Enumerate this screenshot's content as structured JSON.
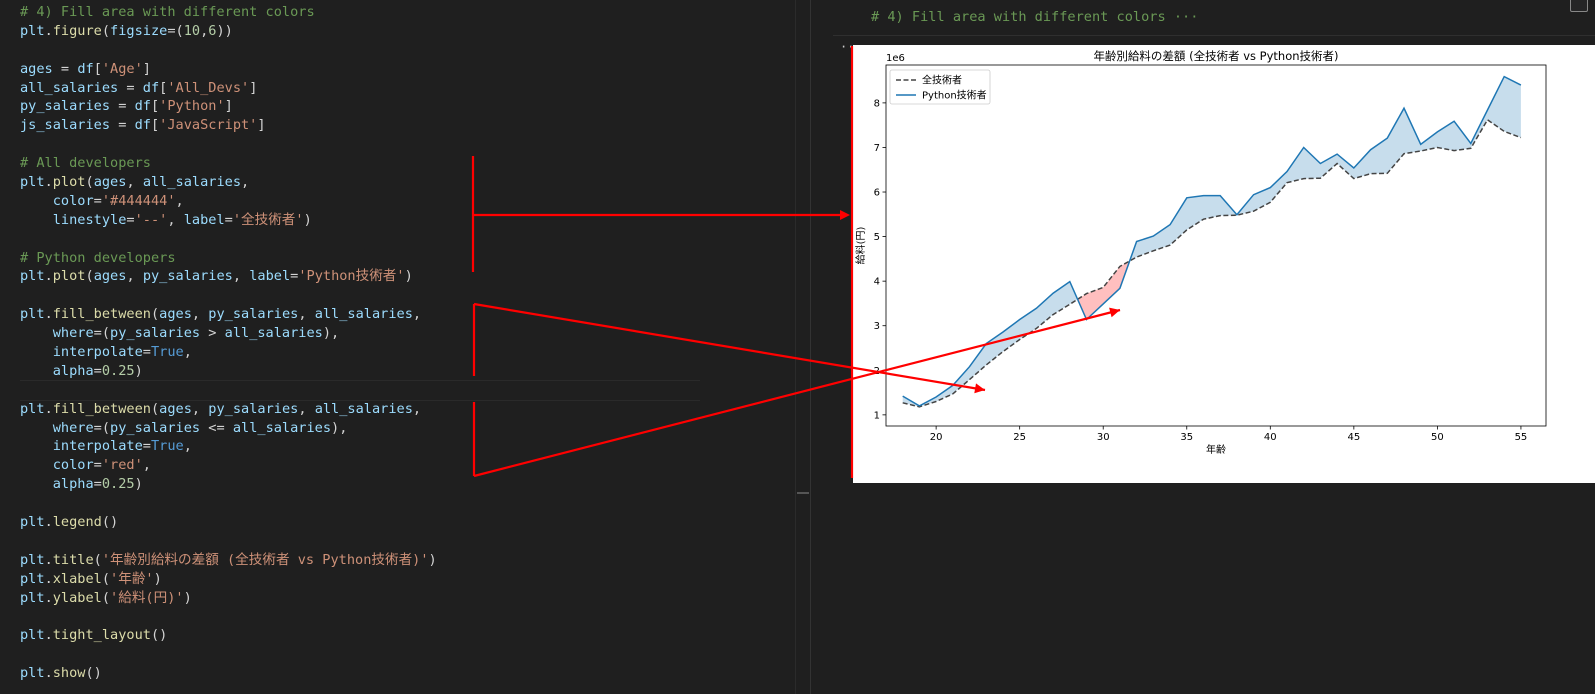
{
  "code": {
    "lines": [
      [
        [
          "t-com",
          "# 4) Fill area with different colors"
        ]
      ],
      [
        [
          "t-var",
          "plt"
        ],
        [
          "t-op",
          "."
        ],
        [
          "t-fn",
          "figure"
        ],
        [
          "t-op",
          "("
        ],
        [
          "t-var",
          "figsize"
        ],
        [
          "t-op",
          "=("
        ],
        [
          "t-num",
          "10"
        ],
        [
          "t-op",
          ","
        ],
        [
          "t-num",
          "6"
        ],
        [
          "t-op",
          "))"
        ]
      ],
      [],
      [
        [
          "t-var",
          "ages"
        ],
        [
          "t-op",
          " = "
        ],
        [
          "t-var",
          "df"
        ],
        [
          "t-op",
          "["
        ],
        [
          "t-str",
          "'Age'"
        ],
        [
          "t-op",
          "]"
        ]
      ],
      [
        [
          "t-var",
          "all_salaries"
        ],
        [
          "t-op",
          " = "
        ],
        [
          "t-var",
          "df"
        ],
        [
          "t-op",
          "["
        ],
        [
          "t-str",
          "'All_Devs'"
        ],
        [
          "t-op",
          "]"
        ]
      ],
      [
        [
          "t-var",
          "py_salaries"
        ],
        [
          "t-op",
          " = "
        ],
        [
          "t-var",
          "df"
        ],
        [
          "t-op",
          "["
        ],
        [
          "t-str",
          "'Python'"
        ],
        [
          "t-op",
          "]"
        ]
      ],
      [
        [
          "t-var",
          "js_salaries"
        ],
        [
          "t-op",
          " = "
        ],
        [
          "t-var",
          "df"
        ],
        [
          "t-op",
          "["
        ],
        [
          "t-str",
          "'JavaScript'"
        ],
        [
          "t-op",
          "]"
        ]
      ],
      [],
      [
        [
          "t-com",
          "# All developers"
        ]
      ],
      [
        [
          "t-var",
          "plt"
        ],
        [
          "t-op",
          "."
        ],
        [
          "t-fn",
          "plot"
        ],
        [
          "t-op",
          "("
        ],
        [
          "t-var",
          "ages"
        ],
        [
          "t-op",
          ", "
        ],
        [
          "t-var",
          "all_salaries"
        ],
        [
          "t-op",
          ","
        ]
      ],
      [
        [
          "t-op",
          "    "
        ],
        [
          "t-var",
          "color"
        ],
        [
          "t-op",
          "="
        ],
        [
          "t-str",
          "'#444444'"
        ],
        [
          "t-op",
          ","
        ]
      ],
      [
        [
          "t-op",
          "    "
        ],
        [
          "t-var",
          "linestyle"
        ],
        [
          "t-op",
          "="
        ],
        [
          "t-str",
          "'--'"
        ],
        [
          "t-op",
          ", "
        ],
        [
          "t-var",
          "label"
        ],
        [
          "t-op",
          "="
        ],
        [
          "t-str",
          "'全技術者'"
        ],
        [
          "t-op",
          ")"
        ]
      ],
      [],
      [
        [
          "t-com",
          "# Python developers"
        ]
      ],
      [
        [
          "t-var",
          "plt"
        ],
        [
          "t-op",
          "."
        ],
        [
          "t-fn",
          "plot"
        ],
        [
          "t-op",
          "("
        ],
        [
          "t-var",
          "ages"
        ],
        [
          "t-op",
          ", "
        ],
        [
          "t-var",
          "py_salaries"
        ],
        [
          "t-op",
          ", "
        ],
        [
          "t-var",
          "label"
        ],
        [
          "t-op",
          "="
        ],
        [
          "t-str",
          "'Python技術者'"
        ],
        [
          "t-op",
          ")"
        ]
      ],
      [],
      [
        [
          "t-var",
          "plt"
        ],
        [
          "t-op",
          "."
        ],
        [
          "t-fn",
          "fill_between"
        ],
        [
          "t-op",
          "("
        ],
        [
          "t-var",
          "ages"
        ],
        [
          "t-op",
          ", "
        ],
        [
          "t-var",
          "py_salaries"
        ],
        [
          "t-op",
          ", "
        ],
        [
          "t-var",
          "all_salaries"
        ],
        [
          "t-op",
          ","
        ]
      ],
      [
        [
          "t-op",
          "    "
        ],
        [
          "t-var",
          "where"
        ],
        [
          "t-op",
          "=("
        ],
        [
          "t-var",
          "py_salaries"
        ],
        [
          "t-op",
          " > "
        ],
        [
          "t-var",
          "all_salaries"
        ],
        [
          "t-op",
          "),"
        ]
      ],
      [
        [
          "t-op",
          "    "
        ],
        [
          "t-var",
          "interpolate"
        ],
        [
          "t-op",
          "="
        ],
        [
          "t-kw",
          "True"
        ],
        [
          "t-op",
          ","
        ]
      ],
      [
        [
          "t-op",
          "    "
        ],
        [
          "t-var",
          "alpha"
        ],
        [
          "t-op",
          "="
        ],
        [
          "t-num",
          "0.25"
        ],
        [
          "t-op",
          ")"
        ]
      ],
      [],
      [
        [
          "t-var",
          "plt"
        ],
        [
          "t-op",
          "."
        ],
        [
          "t-fn",
          "fill_between"
        ],
        [
          "t-op",
          "("
        ],
        [
          "t-var",
          "ages"
        ],
        [
          "t-op",
          ", "
        ],
        [
          "t-var",
          "py_salaries"
        ],
        [
          "t-op",
          ", "
        ],
        [
          "t-var",
          "all_salaries"
        ],
        [
          "t-op",
          ","
        ]
      ],
      [
        [
          "t-op",
          "    "
        ],
        [
          "t-var",
          "where"
        ],
        [
          "t-op",
          "=("
        ],
        [
          "t-var",
          "py_salaries"
        ],
        [
          "t-op",
          " <= "
        ],
        [
          "t-var",
          "all_salaries"
        ],
        [
          "t-op",
          "),"
        ]
      ],
      [
        [
          "t-op",
          "    "
        ],
        [
          "t-var",
          "interpolate"
        ],
        [
          "t-op",
          "="
        ],
        [
          "t-kw",
          "True"
        ],
        [
          "t-op",
          ","
        ]
      ],
      [
        [
          "t-op",
          "    "
        ],
        [
          "t-var",
          "color"
        ],
        [
          "t-op",
          "="
        ],
        [
          "t-str",
          "'red'"
        ],
        [
          "t-op",
          ","
        ]
      ],
      [
        [
          "t-op",
          "    "
        ],
        [
          "t-var",
          "alpha"
        ],
        [
          "t-op",
          "="
        ],
        [
          "t-num",
          "0.25"
        ],
        [
          "t-op",
          ")"
        ]
      ],
      [],
      [
        [
          "t-var",
          "plt"
        ],
        [
          "t-op",
          "."
        ],
        [
          "t-fn",
          "legend"
        ],
        [
          "t-op",
          "()"
        ]
      ],
      [],
      [
        [
          "t-var",
          "plt"
        ],
        [
          "t-op",
          "."
        ],
        [
          "t-fn",
          "title"
        ],
        [
          "t-op",
          "("
        ],
        [
          "t-str",
          "'年齢別給料の差額 (全技術者 vs Python技術者)'"
        ],
        [
          "t-op",
          ")"
        ]
      ],
      [
        [
          "t-var",
          "plt"
        ],
        [
          "t-op",
          "."
        ],
        [
          "t-fn",
          "xlabel"
        ],
        [
          "t-op",
          "("
        ],
        [
          "t-str",
          "'年齢'"
        ],
        [
          "t-op",
          ")"
        ]
      ],
      [
        [
          "t-var",
          "plt"
        ],
        [
          "t-op",
          "."
        ],
        [
          "t-fn",
          "ylabel"
        ],
        [
          "t-op",
          "("
        ],
        [
          "t-str",
          "'給料(円)'"
        ],
        [
          "t-op",
          ")"
        ]
      ],
      [],
      [
        [
          "t-var",
          "plt"
        ],
        [
          "t-op",
          "."
        ],
        [
          "t-fn",
          "tight_layout"
        ],
        [
          "t-op",
          "()"
        ]
      ],
      [],
      [
        [
          "t-var",
          "plt"
        ],
        [
          "t-op",
          "."
        ],
        [
          "t-fn",
          "show"
        ],
        [
          "t-op",
          "()"
        ]
      ]
    ]
  },
  "markdown_cell": {
    "text": "# 4) Fill area with different colors",
    "ellipsis": "···"
  },
  "output": {
    "ellipsis": "···"
  },
  "chart_data": {
    "type": "line",
    "title": "年齢別給料の差額 (全技術者 vs Python技術者)",
    "xlabel": "年齢",
    "ylabel": "給料(円)",
    "offset_label": "1e6",
    "x": [
      18,
      19,
      20,
      21,
      22,
      23,
      24,
      25,
      26,
      27,
      28,
      29,
      30,
      31,
      32,
      33,
      34,
      35,
      36,
      37,
      38,
      39,
      40,
      41,
      42,
      43,
      44,
      45,
      46,
      47,
      48,
      49,
      50,
      51,
      52,
      53,
      54,
      55
    ],
    "series": [
      {
        "name": "全技術者",
        "color": "#444444",
        "linestyle": "dashed",
        "values": [
          1.27,
          1.18,
          1.3,
          1.47,
          1.79,
          2.12,
          2.42,
          2.69,
          2.94,
          3.25,
          3.48,
          3.72,
          3.86,
          4.33,
          4.54,
          4.68,
          4.81,
          5.15,
          5.39,
          5.47,
          5.48,
          5.57,
          5.77,
          6.21,
          6.3,
          6.31,
          6.64,
          6.3,
          6.41,
          6.42,
          6.86,
          6.92,
          7.0,
          6.93,
          6.98,
          7.62,
          7.36,
          7.22
        ]
      },
      {
        "name": "Python技術者",
        "color": "#1f77b4",
        "linestyle": "solid",
        "values": [
          1.42,
          1.2,
          1.4,
          1.66,
          2.08,
          2.6,
          2.86,
          3.14,
          3.39,
          3.73,
          3.99,
          3.14,
          3.49,
          3.84,
          4.89,
          5.01,
          5.27,
          5.87,
          5.92,
          5.92,
          5.49,
          5.94,
          6.1,
          6.46,
          7.0,
          6.64,
          6.85,
          6.54,
          6.95,
          7.21,
          7.88,
          7.07,
          7.35,
          7.59,
          7.09,
          7.84,
          8.59,
          8.4
        ]
      }
    ],
    "xlim": [
      17,
      56.5
    ],
    "ylim": [
      0.75,
      8.85
    ],
    "xticks": [
      20,
      25,
      30,
      35,
      40,
      45,
      50,
      55
    ],
    "yticks": [
      1,
      2,
      3,
      4,
      5,
      6,
      7,
      8
    ],
    "fill_above_color": "#1f77b4",
    "fill_below_color": "#ff0000",
    "legend_loc": "upper left",
    "grid": false
  },
  "annotation_color": "#ff0000"
}
